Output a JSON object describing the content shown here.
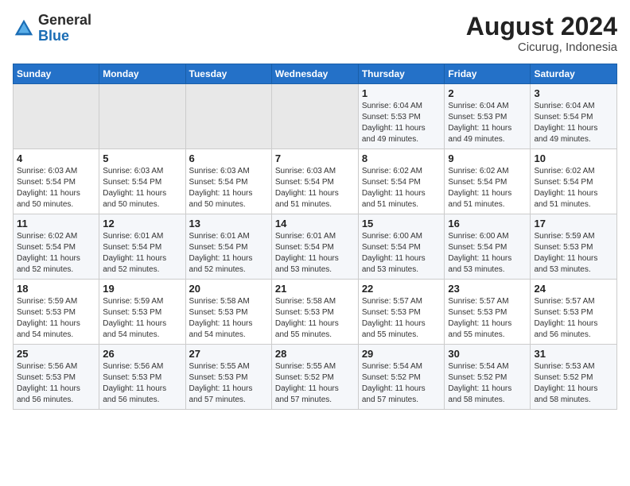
{
  "header": {
    "logo_line1": "General",
    "logo_line2": "Blue",
    "month_year": "August 2024",
    "location": "Cicurug, Indonesia"
  },
  "days_of_week": [
    "Sunday",
    "Monday",
    "Tuesday",
    "Wednesday",
    "Thursday",
    "Friday",
    "Saturday"
  ],
  "weeks": [
    [
      {
        "day": "",
        "info": ""
      },
      {
        "day": "",
        "info": ""
      },
      {
        "day": "",
        "info": ""
      },
      {
        "day": "",
        "info": ""
      },
      {
        "day": "1",
        "info": "Sunrise: 6:04 AM\nSunset: 5:53 PM\nDaylight: 11 hours\nand 49 minutes."
      },
      {
        "day": "2",
        "info": "Sunrise: 6:04 AM\nSunset: 5:53 PM\nDaylight: 11 hours\nand 49 minutes."
      },
      {
        "day": "3",
        "info": "Sunrise: 6:04 AM\nSunset: 5:54 PM\nDaylight: 11 hours\nand 49 minutes."
      }
    ],
    [
      {
        "day": "4",
        "info": "Sunrise: 6:03 AM\nSunset: 5:54 PM\nDaylight: 11 hours\nand 50 minutes."
      },
      {
        "day": "5",
        "info": "Sunrise: 6:03 AM\nSunset: 5:54 PM\nDaylight: 11 hours\nand 50 minutes."
      },
      {
        "day": "6",
        "info": "Sunrise: 6:03 AM\nSunset: 5:54 PM\nDaylight: 11 hours\nand 50 minutes."
      },
      {
        "day": "7",
        "info": "Sunrise: 6:03 AM\nSunset: 5:54 PM\nDaylight: 11 hours\nand 51 minutes."
      },
      {
        "day": "8",
        "info": "Sunrise: 6:02 AM\nSunset: 5:54 PM\nDaylight: 11 hours\nand 51 minutes."
      },
      {
        "day": "9",
        "info": "Sunrise: 6:02 AM\nSunset: 5:54 PM\nDaylight: 11 hours\nand 51 minutes."
      },
      {
        "day": "10",
        "info": "Sunrise: 6:02 AM\nSunset: 5:54 PM\nDaylight: 11 hours\nand 51 minutes."
      }
    ],
    [
      {
        "day": "11",
        "info": "Sunrise: 6:02 AM\nSunset: 5:54 PM\nDaylight: 11 hours\nand 52 minutes."
      },
      {
        "day": "12",
        "info": "Sunrise: 6:01 AM\nSunset: 5:54 PM\nDaylight: 11 hours\nand 52 minutes."
      },
      {
        "day": "13",
        "info": "Sunrise: 6:01 AM\nSunset: 5:54 PM\nDaylight: 11 hours\nand 52 minutes."
      },
      {
        "day": "14",
        "info": "Sunrise: 6:01 AM\nSunset: 5:54 PM\nDaylight: 11 hours\nand 53 minutes."
      },
      {
        "day": "15",
        "info": "Sunrise: 6:00 AM\nSunset: 5:54 PM\nDaylight: 11 hours\nand 53 minutes."
      },
      {
        "day": "16",
        "info": "Sunrise: 6:00 AM\nSunset: 5:54 PM\nDaylight: 11 hours\nand 53 minutes."
      },
      {
        "day": "17",
        "info": "Sunrise: 5:59 AM\nSunset: 5:53 PM\nDaylight: 11 hours\nand 53 minutes."
      }
    ],
    [
      {
        "day": "18",
        "info": "Sunrise: 5:59 AM\nSunset: 5:53 PM\nDaylight: 11 hours\nand 54 minutes."
      },
      {
        "day": "19",
        "info": "Sunrise: 5:59 AM\nSunset: 5:53 PM\nDaylight: 11 hours\nand 54 minutes."
      },
      {
        "day": "20",
        "info": "Sunrise: 5:58 AM\nSunset: 5:53 PM\nDaylight: 11 hours\nand 54 minutes."
      },
      {
        "day": "21",
        "info": "Sunrise: 5:58 AM\nSunset: 5:53 PM\nDaylight: 11 hours\nand 55 minutes."
      },
      {
        "day": "22",
        "info": "Sunrise: 5:57 AM\nSunset: 5:53 PM\nDaylight: 11 hours\nand 55 minutes."
      },
      {
        "day": "23",
        "info": "Sunrise: 5:57 AM\nSunset: 5:53 PM\nDaylight: 11 hours\nand 55 minutes."
      },
      {
        "day": "24",
        "info": "Sunrise: 5:57 AM\nSunset: 5:53 PM\nDaylight: 11 hours\nand 56 minutes."
      }
    ],
    [
      {
        "day": "25",
        "info": "Sunrise: 5:56 AM\nSunset: 5:53 PM\nDaylight: 11 hours\nand 56 minutes."
      },
      {
        "day": "26",
        "info": "Sunrise: 5:56 AM\nSunset: 5:53 PM\nDaylight: 11 hours\nand 56 minutes."
      },
      {
        "day": "27",
        "info": "Sunrise: 5:55 AM\nSunset: 5:53 PM\nDaylight: 11 hours\nand 57 minutes."
      },
      {
        "day": "28",
        "info": "Sunrise: 5:55 AM\nSunset: 5:52 PM\nDaylight: 11 hours\nand 57 minutes."
      },
      {
        "day": "29",
        "info": "Sunrise: 5:54 AM\nSunset: 5:52 PM\nDaylight: 11 hours\nand 57 minutes."
      },
      {
        "day": "30",
        "info": "Sunrise: 5:54 AM\nSunset: 5:52 PM\nDaylight: 11 hours\nand 58 minutes."
      },
      {
        "day": "31",
        "info": "Sunrise: 5:53 AM\nSunset: 5:52 PM\nDaylight: 11 hours\nand 58 minutes."
      }
    ]
  ]
}
